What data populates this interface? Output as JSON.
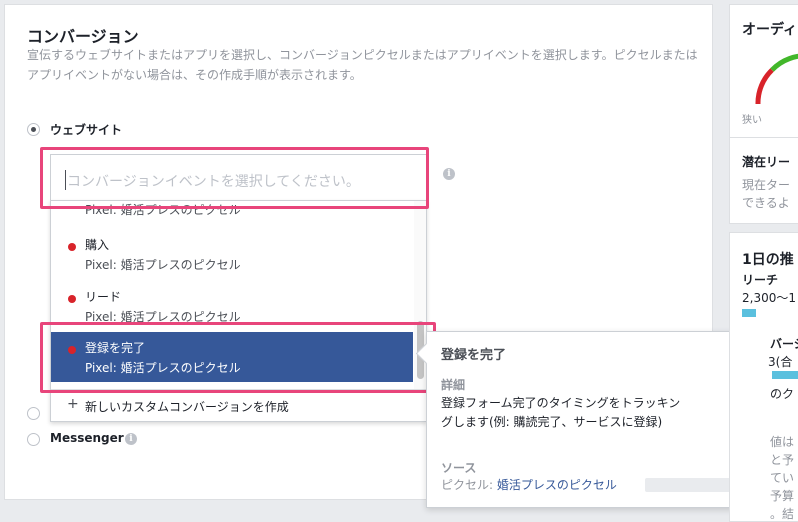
{
  "section": {
    "title": "コンバージョン",
    "description": "宣伝するウェブサイトまたはアプリを選択し、コンバージョンピクセルまたはアプリイベントを選択します。ピクセルまたはアプリイベントがない場合は、その作成手順が表示されます。"
  },
  "options": {
    "website": "ウェブサイト",
    "messenger": "Messenger"
  },
  "search": {
    "placeholder": "コンバージョンイベントを選択してください。"
  },
  "dropdown": {
    "partial_source": "Pixel: 婚活プレスのピクセル",
    "items": [
      {
        "name": "購入",
        "source": "Pixel: 婚活プレスのピクセル"
      },
      {
        "name": "リード",
        "source": "Pixel: 婚活プレスのピクセル"
      },
      {
        "name": "登録を完了",
        "source": "Pixel: 婚活プレスのピクセル"
      }
    ],
    "footer": "新しいカスタムコンバージョンを作成"
  },
  "tooltip": {
    "title": "登録を完了",
    "detail_heading": "詳細",
    "detail_body": "登録フォーム完了のタイミングをトラッキングします(例: 購読完了、サービスに登録)",
    "source_heading": "ソース",
    "source_prefix": "ピクセル: ",
    "source_link": "婚活プレスのピクセル"
  },
  "right": {
    "audience_title": "オーディ",
    "gauge_label": "狭い",
    "potential_title": "潜在リー",
    "potential_line1": "現在ター",
    "potential_line2": "できるよ",
    "daily_title": "1日の推",
    "reach_label": "リーチ",
    "reach_value": "2,300〜1",
    "conv_title": "バージ",
    "conv_sub": "3(合",
    "conv_ku": "のク",
    "frag1": "値は",
    "frag2": "と予",
    "frag3": "てい",
    "frag4": "予算",
    "frag5": "。結"
  },
  "colors": {
    "accent": "#365899",
    "highlight": "#e8457b",
    "dot": "#d8232a",
    "bar": "#5bc0de"
  }
}
